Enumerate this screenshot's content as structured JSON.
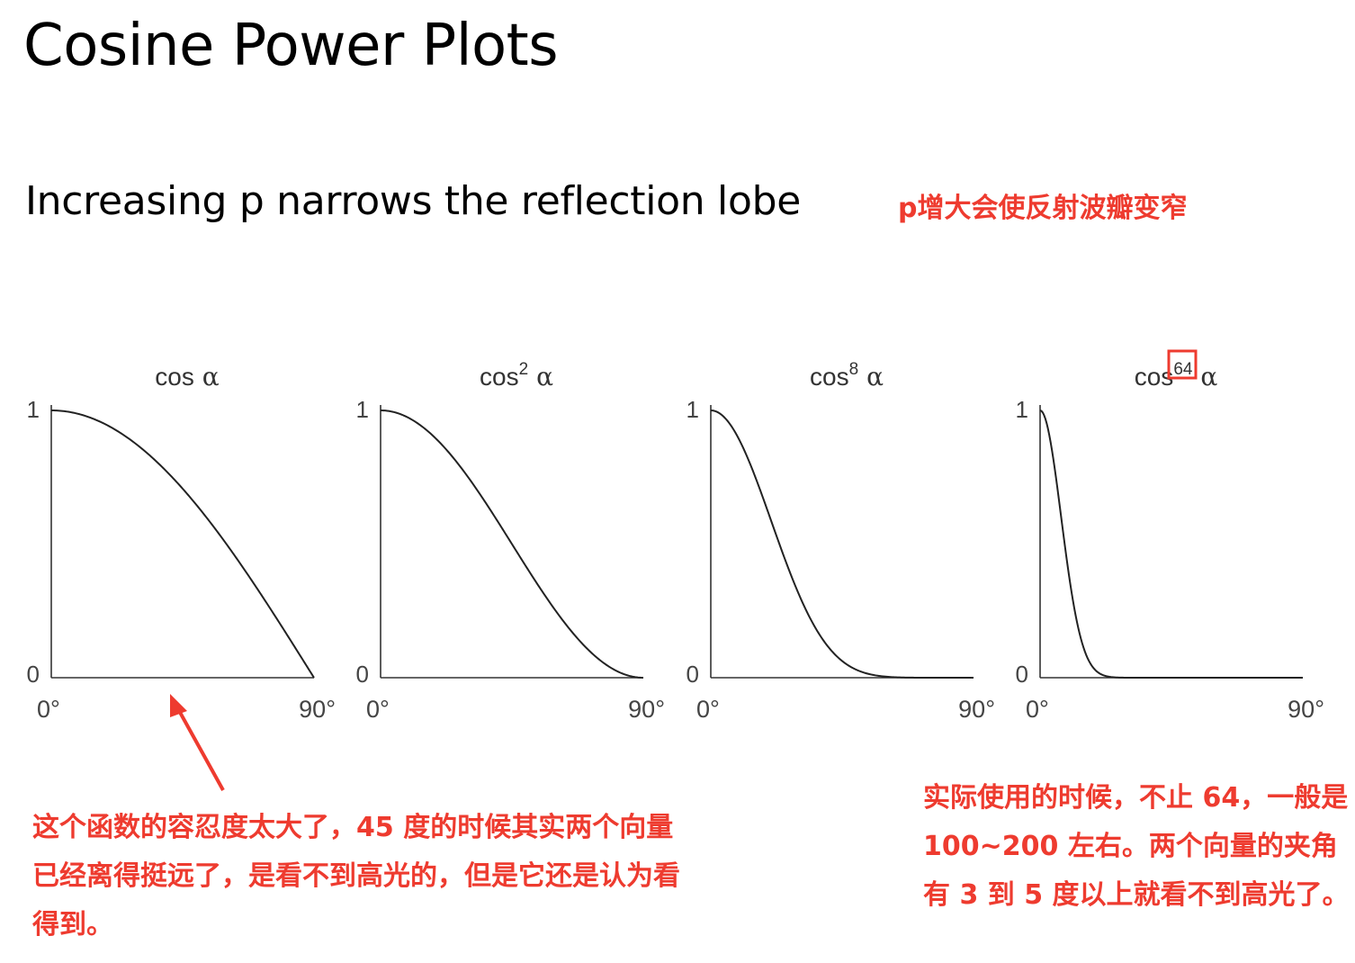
{
  "slide": {
    "title": "Cosine Power Plots",
    "subtitle": "Increasing p narrows the reflection lobe",
    "note_top": "p增大会使反射波瓣变窄",
    "note_left": "这个函数的容忍度太大了，45 度的时候其实两个向量已经离得挺远了，是看不到高光的，但是它还是认为看得到。",
    "note_right": "实际使用的时候，不止 64，一般是 100~200 左右。两个向量的夹角有 3 到 5 度以上就看不到高光了。"
  },
  "colors": {
    "annotation": "#ee3b2f",
    "curve": "#222222",
    "axis": "#333333"
  },
  "chart_data": [
    {
      "type": "line",
      "title_base": "cos",
      "exponent": "",
      "title_var": "α",
      "p": 1,
      "x_tick_labels": [
        "0°",
        "90°"
      ],
      "y_tick_labels": [
        "0",
        "1"
      ],
      "xlim": [
        0,
        90
      ],
      "ylim": [
        0,
        1
      ],
      "x": [
        0,
        15,
        30,
        45,
        60,
        75,
        90
      ],
      "y": [
        1,
        0.966,
        0.866,
        0.707,
        0.5,
        0.259,
        0
      ]
    },
    {
      "type": "line",
      "title_base": "cos",
      "exponent": "2",
      "title_var": "α",
      "p": 2,
      "x_tick_labels": [
        "0°",
        "90°"
      ],
      "y_tick_labels": [
        "0",
        "1"
      ],
      "xlim": [
        0,
        90
      ],
      "ylim": [
        0,
        1
      ],
      "x": [
        0,
        15,
        30,
        45,
        60,
        75,
        90
      ],
      "y": [
        1,
        0.933,
        0.75,
        0.5,
        0.25,
        0.067,
        0
      ]
    },
    {
      "type": "line",
      "title_base": "cos",
      "exponent": "8",
      "title_var": "α",
      "p": 8,
      "x_tick_labels": [
        "0°",
        "90°"
      ],
      "y_tick_labels": [
        "0",
        "1"
      ],
      "xlim": [
        0,
        90
      ],
      "ylim": [
        0,
        1
      ],
      "x": [
        0,
        15,
        30,
        45,
        60,
        75,
        90
      ],
      "y": [
        1,
        0.758,
        0.316,
        0.063,
        0.004,
        0,
        0
      ]
    },
    {
      "type": "line",
      "title_base": "cos",
      "exponent": "64",
      "title_var": "α",
      "p": 64,
      "exponent_highlighted": true,
      "x_tick_labels": [
        "0°",
        "90°"
      ],
      "y_tick_labels": [
        "0",
        "1"
      ],
      "xlim": [
        0,
        90
      ],
      "ylim": [
        0,
        1
      ],
      "x": [
        0,
        5,
        10,
        15,
        20,
        30,
        90
      ],
      "y": [
        1,
        0.78,
        0.376,
        0.109,
        0.019,
        0,
        0
      ]
    }
  ]
}
